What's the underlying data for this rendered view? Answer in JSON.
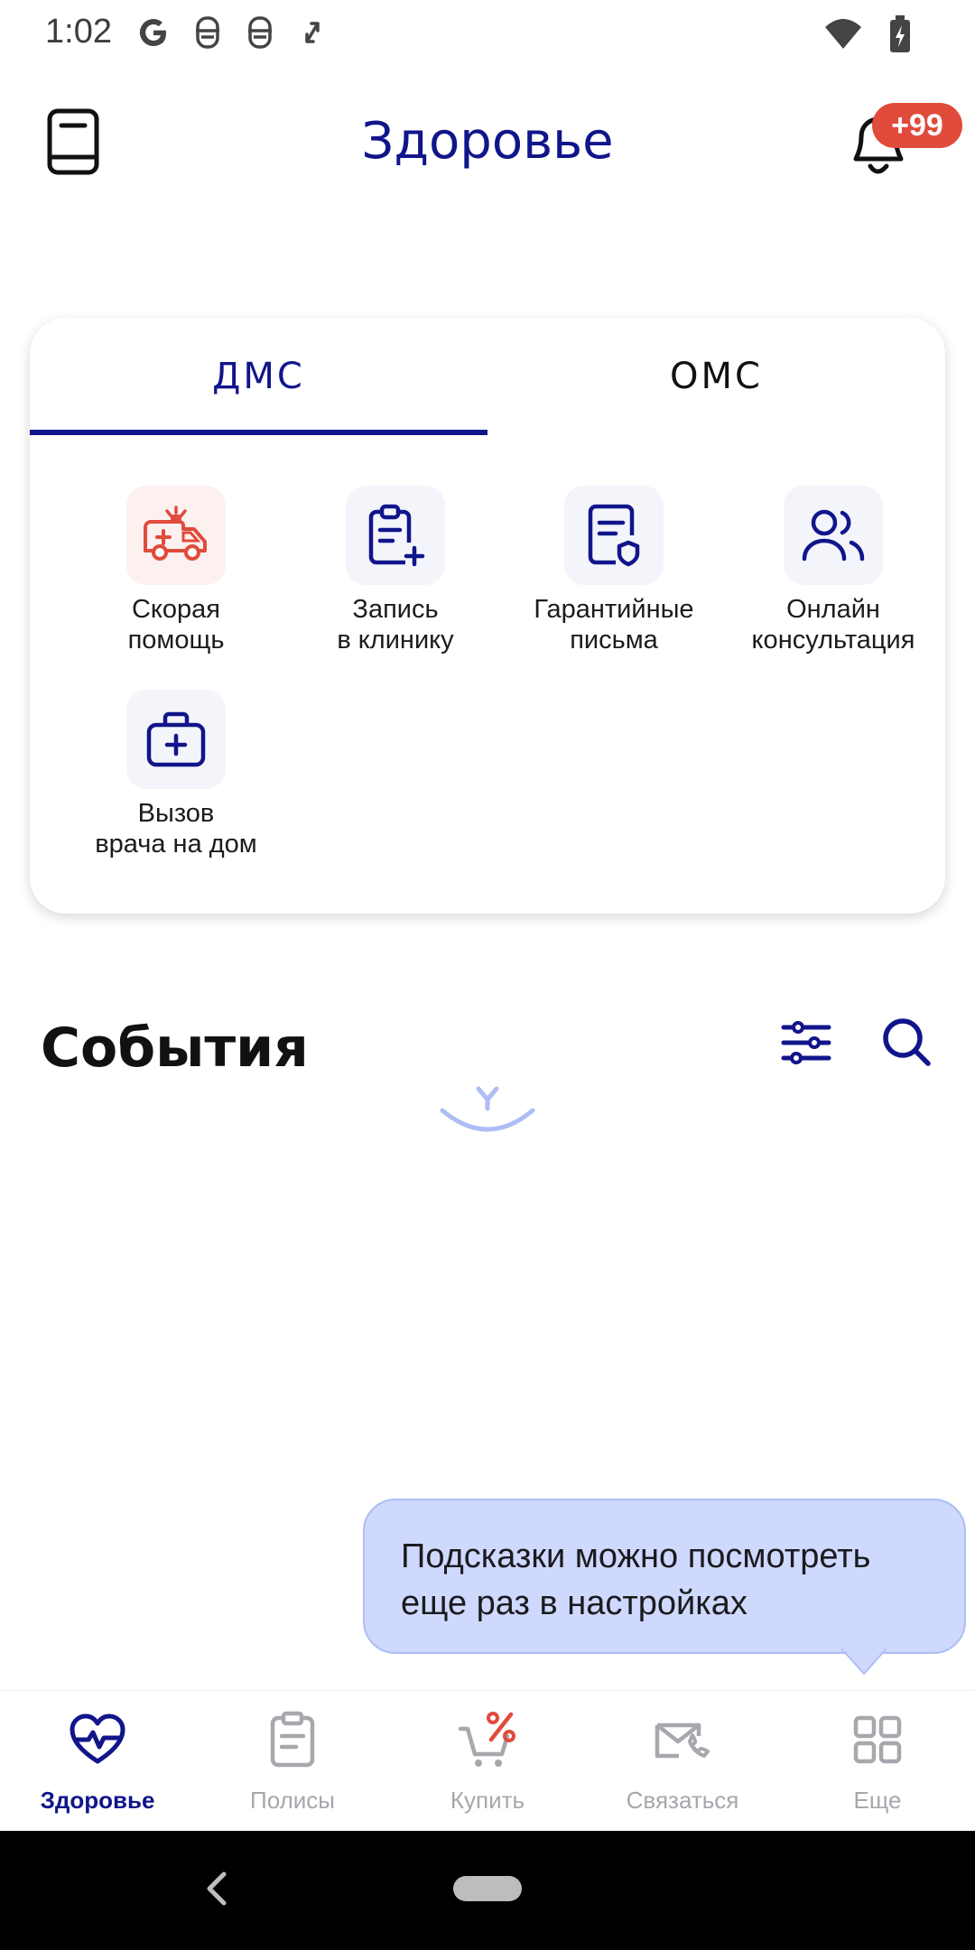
{
  "status_bar": {
    "time": "1:02",
    "left_icons": [
      "google-g-icon",
      "incognito-icon",
      "incognito-icon",
      "screen-rotate-icon"
    ],
    "right_icons": [
      "wifi-icon",
      "battery-charging-icon"
    ]
  },
  "header": {
    "title": "Здоровье",
    "left_icon": "policy-card-icon",
    "notification_badge": "+99"
  },
  "card": {
    "tabs": [
      {
        "label": "ДМС",
        "active": true
      },
      {
        "label": "ОМС",
        "active": false
      }
    ],
    "services": [
      {
        "label": "Скорая\nпомощь",
        "icon": "ambulance-icon"
      },
      {
        "label": "Запись\nв клинику",
        "icon": "clipboard-plus-icon"
      },
      {
        "label": "Гарантийные\nписьма",
        "icon": "document-shield-icon"
      },
      {
        "label": "Онлайн\nконсультация",
        "icon": "users-icon"
      },
      {
        "label": "Вызов\nврача на дом",
        "icon": "medical-bag-icon"
      }
    ]
  },
  "events": {
    "title": "События"
  },
  "tooltip": {
    "text": "Подсказки можно посмотреть еще раз в настройках"
  },
  "bottom_nav": {
    "items": [
      {
        "label": "Здоровье",
        "icon": "heart-pulse-icon",
        "active": true
      },
      {
        "label": "Полисы",
        "icon": "clipboard-icon",
        "active": false
      },
      {
        "label": "Купить",
        "icon": "cart-percent-icon",
        "active": false
      },
      {
        "label": "Связаться",
        "icon": "envelope-phone-icon",
        "active": false
      },
      {
        "label": "Еще",
        "icon": "grid-icon",
        "active": false
      }
    ]
  },
  "colors": {
    "brand": "#11158a",
    "accent_red": "#e14b3b",
    "tooltip_bg": "#cfd9fd",
    "inactive": "#a7a7ad"
  }
}
